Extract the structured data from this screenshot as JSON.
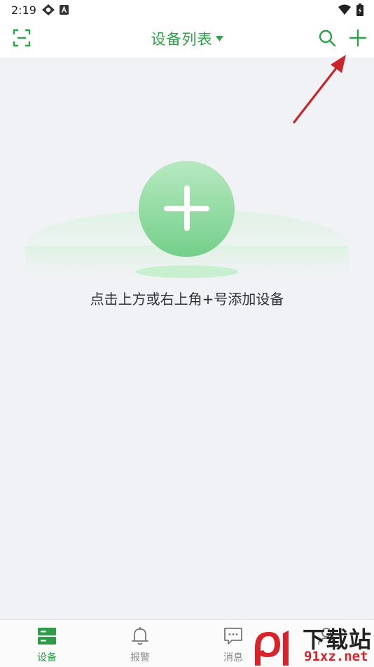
{
  "status_bar": {
    "time": "2:19"
  },
  "app_bar": {
    "title": "设备列表"
  },
  "empty_state": {
    "hint": "点击上方或右上角+号添加设备"
  },
  "bottom_nav": {
    "items": [
      {
        "label": "设备",
        "icon": "device-icon",
        "active": true
      },
      {
        "label": "报警",
        "icon": "bell-icon",
        "active": false
      },
      {
        "label": "消息",
        "icon": "message-icon",
        "active": false
      },
      {
        "label": "",
        "icon": "person-icon",
        "active": false
      }
    ]
  },
  "watermark": {
    "title": "下载站",
    "url": "91xz.net"
  },
  "colors": {
    "accent": "#29a446",
    "add_circle_top": "#b7e9c1",
    "add_circle_bottom": "#74cf89",
    "annotation_arrow": "#d42a2a",
    "background": "#f1f2f5"
  }
}
